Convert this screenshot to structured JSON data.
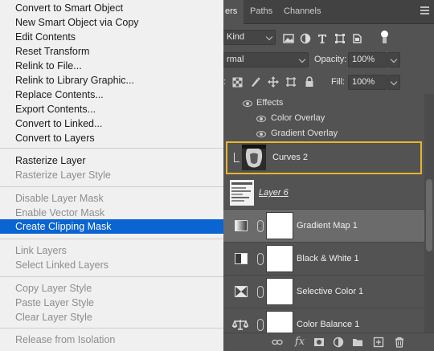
{
  "context_menu": {
    "items": [
      {
        "label": "Convert to Smart Object",
        "enabled": true
      },
      {
        "label": "New Smart Object via Copy",
        "enabled": true
      },
      {
        "label": "Edit Contents",
        "enabled": true
      },
      {
        "label": "Reset Transform",
        "enabled": true
      },
      {
        "label": "Relink to File...",
        "enabled": true
      },
      {
        "label": "Relink to Library Graphic...",
        "enabled": true
      },
      {
        "label": "Replace Contents...",
        "enabled": true
      },
      {
        "label": "Export Contents...",
        "enabled": true
      },
      {
        "label": "Convert to Linked...",
        "enabled": true
      },
      {
        "label": "Convert to Layers",
        "enabled": true
      },
      {
        "label": "Rasterize Layer",
        "enabled": true
      },
      {
        "label": "Rasterize Layer Style",
        "enabled": false
      },
      {
        "label": "Disable Layer Mask",
        "enabled": false
      },
      {
        "label": "Enable Vector Mask",
        "enabled": false
      },
      {
        "label": "Create Clipping Mask",
        "enabled": true,
        "highlighted": true
      },
      {
        "label": "Link Layers",
        "enabled": false
      },
      {
        "label": "Select Linked Layers",
        "enabled": false
      },
      {
        "label": "Copy Layer Style",
        "enabled": false
      },
      {
        "label": "Paste Layer Style",
        "enabled": false
      },
      {
        "label": "Clear Layer Style",
        "enabled": false
      },
      {
        "label": "Release from Isolation",
        "enabled": false
      }
    ],
    "highlight_color": "#0a64d2",
    "disabled_color": "#8d8d8d"
  },
  "layers_panel": {
    "tabs": [
      {
        "label": "ers",
        "active": true
      },
      {
        "label": "Paths",
        "active": false
      },
      {
        "label": "Channels",
        "active": false
      }
    ],
    "filter": {
      "kind_label": "Kind"
    },
    "blend": {
      "mode": "rmal",
      "opacity_label": "Opacity:",
      "opacity_value": "100%"
    },
    "lock": {
      "fill_label": "Fill:",
      "fill_value": "100%"
    },
    "effects": {
      "header": "Effects",
      "items": [
        "Color Overlay",
        "Gradient Overlay"
      ]
    },
    "layers": [
      {
        "name": "Curves 2",
        "type": "smart-object",
        "highlight_border": "#e8b52c"
      },
      {
        "name": "Layer 6",
        "type": "pixel"
      },
      {
        "name": "Gradient Map 1",
        "type": "adjustment",
        "icon": "gradient-map-icon",
        "selected": true
      },
      {
        "name": "Black & White 1",
        "type": "adjustment",
        "icon": "black-white-icon"
      },
      {
        "name": "Selective Color 1",
        "type": "adjustment",
        "icon": "selective-color-icon"
      },
      {
        "name": "Color Balance 1",
        "type": "adjustment",
        "icon": "color-balance-icon"
      }
    ],
    "bottom_icons": [
      "link-icon",
      "fx-icon",
      "mask-icon",
      "adjustment-icon",
      "folder-icon",
      "new-layer-icon",
      "trash-icon"
    ],
    "fx_label": "fx"
  }
}
